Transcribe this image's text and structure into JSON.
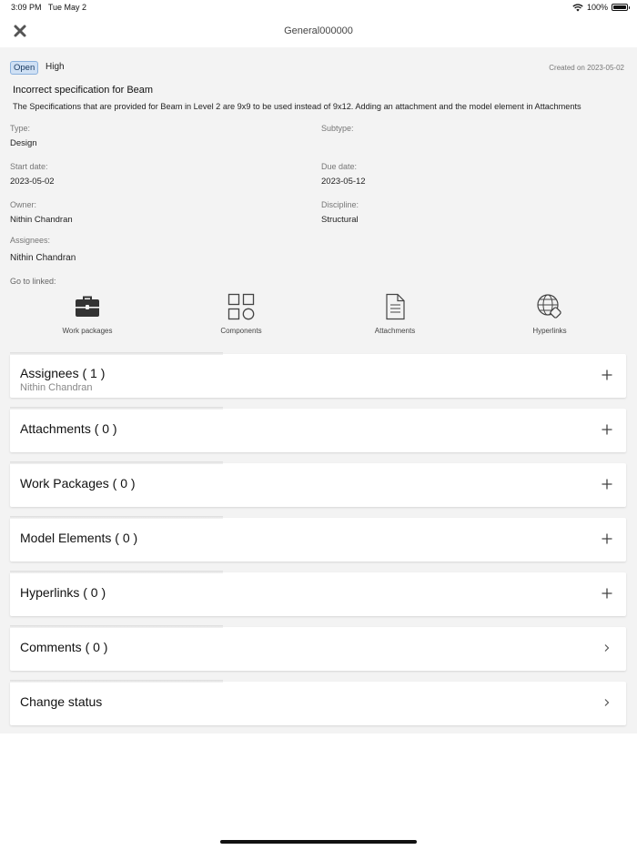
{
  "status_bar": {
    "time": "3:09 PM",
    "date": "Tue May 2",
    "battery": "100%"
  },
  "nav": {
    "title": "General000000",
    "close_icon": "close-icon"
  },
  "issue": {
    "status": "Open",
    "priority": "High",
    "created": "Created on 2023-05-02",
    "title": "Incorrect specification for Beam",
    "description": "The Specifications that are provided for Beam in Level 2 are 9x9 to be used instead of 9x12. Adding an attachment and the model element in Attachments"
  },
  "fields": {
    "type_label": "Type:",
    "type_value": "Design",
    "subtype_label": "Subtype:",
    "subtype_value": "",
    "start_label": "Start date:",
    "start_value": "2023-05-02",
    "due_label": "Due date:",
    "due_value": "2023-05-12",
    "owner_label": "Owner:",
    "owner_value": "Nithin Chandran",
    "discipline_label": "Discipline:",
    "discipline_value": "Structural",
    "assignees_label": "Assignees:",
    "assignees_value": "Nithin Chandran"
  },
  "linked": {
    "label": "Go to linked:",
    "items": [
      {
        "label": "Work packages",
        "icon": "briefcase-icon"
      },
      {
        "label": "Components",
        "icon": "components-icon"
      },
      {
        "label": "Attachments",
        "icon": "document-icon"
      },
      {
        "label": "Hyperlinks",
        "icon": "globe-link-icon"
      }
    ]
  },
  "sections": [
    {
      "title": "Assignees ( 1 )",
      "subtitle": "Nithin Chandran",
      "action": "plus-icon"
    },
    {
      "title": "Attachments ( 0 )",
      "action": "plus-icon"
    },
    {
      "title": "Work Packages ( 0 )",
      "action": "plus-icon"
    },
    {
      "title": "Model Elements ( 0 )",
      "action": "plus-icon"
    },
    {
      "title": "Hyperlinks ( 0 )",
      "action": "plus-icon"
    },
    {
      "title": "Comments ( 0 )",
      "action": "chevron-right-icon"
    },
    {
      "title": "Change status",
      "action": "chevron-right-icon"
    }
  ]
}
